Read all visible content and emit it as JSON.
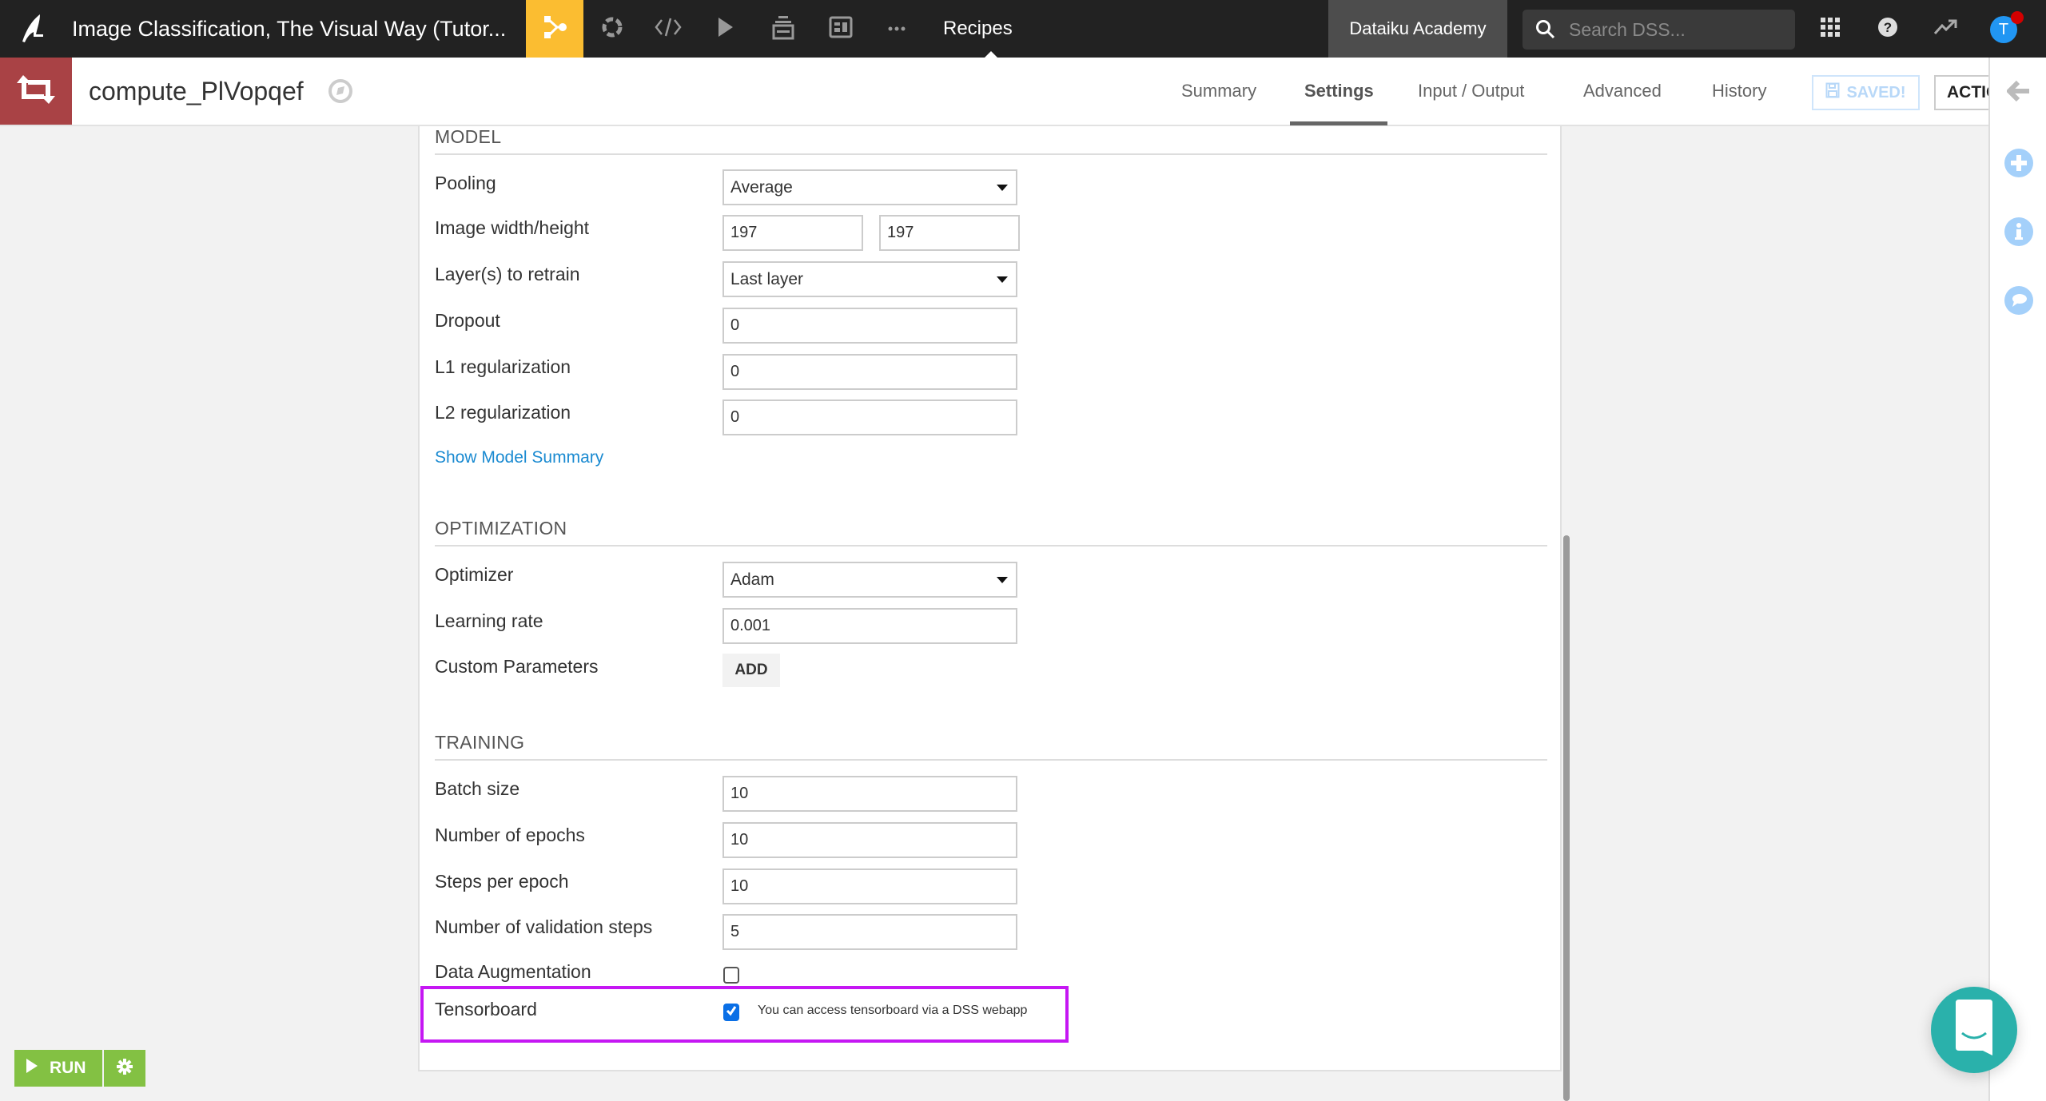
{
  "topnav": {
    "app_title": "Image Classification, The Visual Way (Tutor...",
    "current_section": "Recipes",
    "instance_name": "Dataiku Academy",
    "search_placeholder": "Search DSS...",
    "avatar_initial": "T",
    "nav_icons": [
      "flow-icon",
      "lab-icon",
      "code-icon",
      "run-jobs-icon",
      "datasets-stack-icon",
      "dashboard-icon",
      "more-icon"
    ],
    "accent_color": "#fbbd31"
  },
  "recipe": {
    "name": "compute_PlVopqef",
    "icon_color": "#a94245",
    "tabs": [
      {
        "label": "Summary",
        "active": false
      },
      {
        "label": "Settings",
        "active": true
      },
      {
        "label": "Input / Output",
        "active": false
      },
      {
        "label": "Advanced",
        "active": false
      },
      {
        "label": "History",
        "active": false
      }
    ],
    "saved_label": "SAVED!",
    "actions_label": "ACTIONS"
  },
  "model": {
    "title": "MODEL",
    "pooling": {
      "label": "Pooling",
      "value": "Average"
    },
    "image_size": {
      "label": "Image width/height",
      "width": "197",
      "height": "197"
    },
    "layers": {
      "label": "Layer(s) to retrain",
      "value": "Last layer"
    },
    "dropout": {
      "label": "Dropout",
      "value": "0"
    },
    "l1": {
      "label": "L1 regularization",
      "value": "0"
    },
    "l2": {
      "label": "L2 regularization",
      "value": "0"
    },
    "summary_link": "Show Model Summary"
  },
  "optimization": {
    "title": "OPTIMIZATION",
    "optimizer": {
      "label": "Optimizer",
      "value": "Adam"
    },
    "learning_rate": {
      "label": "Learning rate",
      "value": "0.001"
    },
    "custom_params": {
      "label": "Custom Parameters",
      "button": "ADD"
    }
  },
  "training": {
    "title": "TRAINING",
    "batch_size": {
      "label": "Batch size",
      "value": "10"
    },
    "epochs": {
      "label": "Number of epochs",
      "value": "10"
    },
    "steps": {
      "label": "Steps per epoch",
      "value": "10"
    },
    "validation_steps": {
      "label": "Number of validation steps",
      "value": "5"
    },
    "data_augmentation": {
      "label": "Data Augmentation",
      "checked": false
    },
    "tensorboard": {
      "label": "Tensorboard",
      "checked": true,
      "note": "You can access tensorboard via a DSS webapp"
    }
  },
  "run": {
    "label": "RUN",
    "color": "#83c143"
  },
  "highlight_color": "#c517f3"
}
